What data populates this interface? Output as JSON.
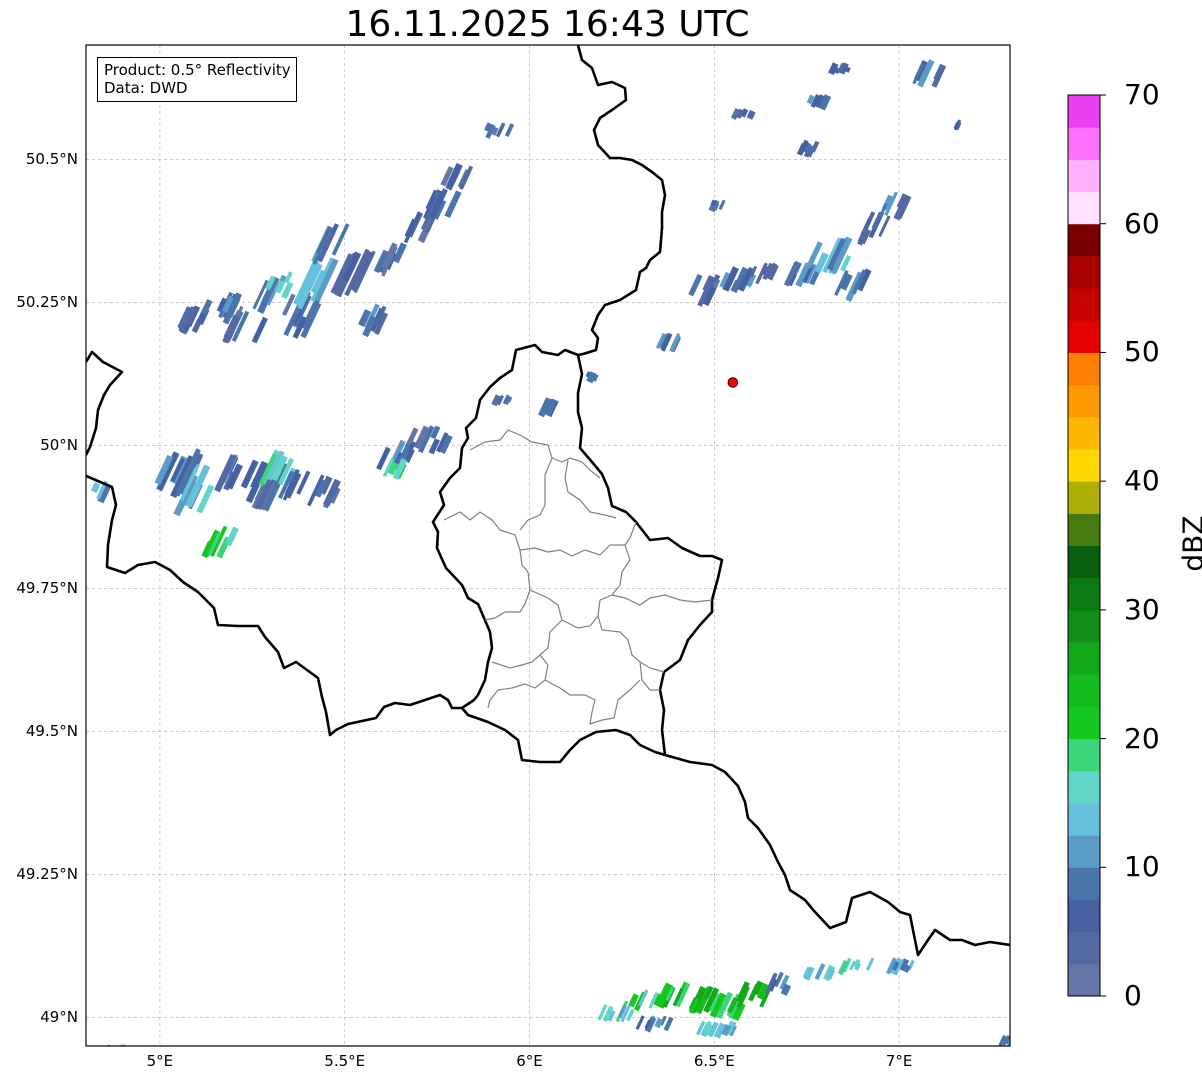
{
  "title": "16.11.2025 16:43 UTC",
  "info": {
    "product": "Product: 0.5° Reflectivity",
    "source": "Data: DWD"
  },
  "axes": {
    "lon_range": [
      4.8,
      7.3
    ],
    "lat_range": [
      48.95,
      50.7
    ],
    "lon_ticks": [
      {
        "value": 5.0,
        "label": "5°E"
      },
      {
        "value": 5.5,
        "label": "5.5°E"
      },
      {
        "value": 6.0,
        "label": "6°E"
      },
      {
        "value": 6.5,
        "label": "6.5°E"
      },
      {
        "value": 7.0,
        "label": "7°E"
      }
    ],
    "lat_ticks": [
      {
        "value": 50.5,
        "label": "50.5°N"
      },
      {
        "value": 50.25,
        "label": "50.25°N"
      },
      {
        "value": 50.0,
        "label": "50°N"
      },
      {
        "value": 49.75,
        "label": "49.75°N"
      },
      {
        "value": 49.5,
        "label": "49.5°N"
      },
      {
        "value": 49.25,
        "label": "49.25°N"
      },
      {
        "value": 49.0,
        "label": "49°N"
      }
    ],
    "grid": true
  },
  "radar_site": {
    "lon": 6.55,
    "lat": 50.11,
    "color": "#ff0000"
  },
  "colorbar": {
    "unit": "dBZ",
    "min": 0,
    "max": 70,
    "tick_labels": [
      "0",
      "10",
      "20",
      "30",
      "40",
      "50",
      "60",
      "70"
    ],
    "colors": [
      "#6476a8",
      "#5468a3",
      "#4561a2",
      "#4a74ab",
      "#5a9bc7",
      "#66c1dc",
      "#61d6c8",
      "#3dd57a",
      "#13c71f",
      "#13bb1d",
      "#12a81a",
      "#118e17",
      "#0c7a13",
      "#0a5f0e",
      "#477a10",
      "#aeb006",
      "#ffd700",
      "#ffb800",
      "#ff9900",
      "#ff7d00",
      "#e60000",
      "#c70000",
      "#a80000",
      "#7a0000",
      "#ffe0ff",
      "#ffb0ff",
      "#ff70ff",
      "#e93ef2"
    ]
  },
  "echoes": [
    {
      "name": "echo-band-nw",
      "cells": [
        [
          5.05,
          50.22,
          0.1,
          0.05,
          2
        ],
        [
          5.12,
          50.24,
          0.09,
          0.06,
          3
        ],
        [
          5.2,
          50.21,
          0.08,
          0.07,
          2
        ],
        [
          5.28,
          50.26,
          0.06,
          0.08,
          3
        ],
        [
          5.35,
          50.23,
          0.08,
          0.09,
          2
        ],
        [
          5.4,
          50.28,
          0.07,
          0.1,
          5
        ],
        [
          5.45,
          50.35,
          0.06,
          0.08,
          3
        ],
        [
          5.5,
          50.3,
          0.08,
          0.09,
          2
        ],
        [
          5.55,
          50.22,
          0.06,
          0.06,
          3
        ],
        [
          5.6,
          50.32,
          0.06,
          0.07,
          2
        ],
        [
          5.68,
          50.38,
          0.06,
          0.06,
          2
        ],
        [
          5.73,
          50.42,
          0.08,
          0.06,
          3
        ],
        [
          5.78,
          50.47,
          0.06,
          0.05,
          2
        ],
        [
          5.88,
          50.55,
          0.07,
          0.03,
          2
        ],
        [
          5.3,
          50.28,
          0.05,
          0.05,
          6
        ]
      ]
    },
    {
      "name": "echo-band-w",
      "cells": [
        [
          5.02,
          49.95,
          0.1,
          0.09,
          3
        ],
        [
          5.08,
          49.92,
          0.08,
          0.1,
          5
        ],
        [
          5.12,
          49.83,
          0.08,
          0.06,
          7
        ],
        [
          5.18,
          49.95,
          0.08,
          0.07,
          3
        ],
        [
          5.25,
          49.93,
          0.09,
          0.1,
          2
        ],
        [
          5.3,
          49.96,
          0.06,
          0.07,
          6
        ],
        [
          5.35,
          49.93,
          0.07,
          0.06,
          3
        ],
        [
          5.42,
          49.92,
          0.06,
          0.06,
          2
        ],
        [
          5.6,
          49.98,
          0.08,
          0.06,
          3
        ],
        [
          5.62,
          49.96,
          0.04,
          0.04,
          7
        ],
        [
          5.68,
          50.01,
          0.1,
          0.05,
          2
        ],
        [
          4.82,
          49.92,
          0.04,
          0.04,
          5
        ]
      ]
    },
    {
      "name": "echo-band-ne",
      "cells": [
        [
          6.45,
          50.27,
          0.06,
          0.06,
          2
        ],
        [
          6.52,
          50.29,
          0.08,
          0.05,
          3
        ],
        [
          6.6,
          50.3,
          0.07,
          0.04,
          2
        ],
        [
          6.7,
          50.3,
          0.08,
          0.05,
          3
        ],
        [
          6.78,
          50.33,
          0.1,
          0.07,
          5
        ],
        [
          6.84,
          50.28,
          0.08,
          0.06,
          3
        ],
        [
          6.9,
          50.38,
          0.08,
          0.06,
          2
        ],
        [
          6.96,
          50.42,
          0.06,
          0.05,
          3
        ],
        [
          6.35,
          50.18,
          0.07,
          0.04,
          3
        ],
        [
          6.48,
          50.42,
          0.05,
          0.02,
          2
        ],
        [
          6.73,
          50.52,
          0.06,
          0.03,
          2
        ],
        [
          6.75,
          50.6,
          0.07,
          0.03,
          3
        ],
        [
          6.55,
          50.58,
          0.05,
          0.02,
          2
        ],
        [
          7.05,
          50.65,
          0.07,
          0.05,
          3
        ],
        [
          6.82,
          50.66,
          0.05,
          0.02,
          2
        ],
        [
          7.15,
          50.56,
          0.03,
          0.02,
          2
        ],
        [
          6.15,
          50.12,
          0.03,
          0.02,
          2
        ],
        [
          6.04,
          50.07,
          0.04,
          0.04,
          3
        ],
        [
          5.9,
          50.08,
          0.05,
          0.02,
          2
        ]
      ]
    },
    {
      "name": "echo-band-south",
      "cells": [
        [
          6.2,
          49.01,
          0.08,
          0.04,
          6
        ],
        [
          6.28,
          49.03,
          0.07,
          0.04,
          7
        ],
        [
          6.35,
          49.04,
          0.08,
          0.05,
          9
        ],
        [
          6.42,
          49.03,
          0.08,
          0.05,
          10
        ],
        [
          6.5,
          49.02,
          0.08,
          0.05,
          8
        ],
        [
          6.58,
          49.04,
          0.08,
          0.05,
          10
        ],
        [
          6.65,
          49.06,
          0.06,
          0.04,
          3
        ],
        [
          6.75,
          49.08,
          0.08,
          0.03,
          5
        ],
        [
          6.85,
          49.09,
          0.08,
          0.03,
          6
        ],
        [
          6.98,
          49.09,
          0.06,
          0.03,
          4
        ],
        [
          6.3,
          48.99,
          0.08,
          0.03,
          3
        ],
        [
          6.45,
          48.98,
          0.12,
          0.03,
          5
        ],
        [
          4.85,
          48.94,
          0.06,
          0.03,
          5
        ],
        [
          7.28,
          48.96,
          0.03,
          0.02,
          3
        ]
      ]
    }
  ]
}
